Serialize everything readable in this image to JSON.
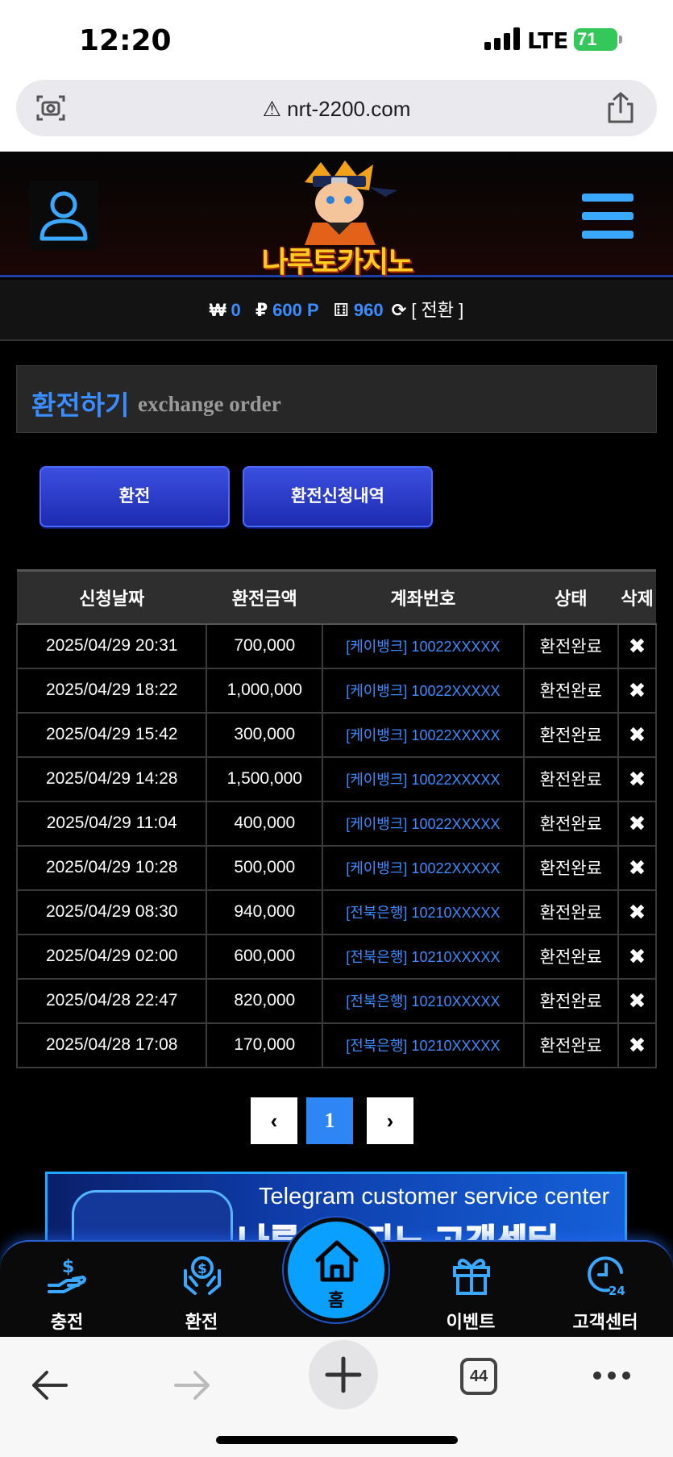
{
  "status_bar": {
    "time": "12:20",
    "network": "LTE",
    "battery": "71"
  },
  "browser": {
    "url": "nrt-2200.com",
    "tab_count": "44"
  },
  "header": {
    "logo_text": "나루토카지노"
  },
  "balance": {
    "won_icon": "₩",
    "won_value": "0",
    "point_icon": "₽",
    "point_value": "600 P",
    "chip_icon": "⚅",
    "chip_value": "960",
    "convert_label": "[ 전환 ]"
  },
  "page": {
    "title_ko": "환전하기",
    "title_en": "exchange order",
    "btn_exchange": "환전",
    "btn_history": "환전신청내역"
  },
  "table": {
    "headers": [
      "신청날짜",
      "환전금액",
      "계좌번호",
      "상태",
      "삭제"
    ],
    "rows": [
      {
        "date": "2025/04/29 20:31",
        "amount": "700,000",
        "account": "[케이뱅크] 10022XXXXX",
        "status": "환전완료",
        "delete": "✖"
      },
      {
        "date": "2025/04/29 18:22",
        "amount": "1,000,000",
        "account": "[케이뱅크] 10022XXXXX",
        "status": "환전완료",
        "delete": "✖"
      },
      {
        "date": "2025/04/29 15:42",
        "amount": "300,000",
        "account": "[케이뱅크] 10022XXXXX",
        "status": "환전완료",
        "delete": "✖"
      },
      {
        "date": "2025/04/29 14:28",
        "amount": "1,500,000",
        "account": "[케이뱅크] 10022XXXXX",
        "status": "환전완료",
        "delete": "✖"
      },
      {
        "date": "2025/04/29 11:04",
        "amount": "400,000",
        "account": "[케이뱅크] 10022XXXXX",
        "status": "환전완료",
        "delete": "✖"
      },
      {
        "date": "2025/04/29 10:28",
        "amount": "500,000",
        "account": "[케이뱅크] 10022XXXXX",
        "status": "환전완료",
        "delete": "✖"
      },
      {
        "date": "2025/04/29 08:30",
        "amount": "940,000",
        "account": "[전북은행] 10210XXXXX",
        "status": "환전완료",
        "delete": "✖"
      },
      {
        "date": "2025/04/29 02:00",
        "amount": "600,000",
        "account": "[전북은행] 10210XXXXX",
        "status": "환전완료",
        "delete": "✖"
      },
      {
        "date": "2025/04/28 22:47",
        "amount": "820,000",
        "account": "[전북은행] 10210XXXXX",
        "status": "환전완료",
        "delete": "✖"
      },
      {
        "date": "2025/04/28 17:08",
        "amount": "170,000",
        "account": "[전북은행] 10210XXXXX",
        "status": "환전완료",
        "delete": "✖"
      }
    ]
  },
  "pagination": {
    "prev": "‹",
    "current": "1",
    "next": "›"
  },
  "banner": {
    "title_en": "Telegram customer service center",
    "title_ko": "나루토카지노 고객센터"
  },
  "bottom_nav": {
    "charge": "충전",
    "exchange": "환전",
    "home": "홈",
    "event": "이벤트",
    "support": "고객센터"
  },
  "colors": {
    "accent": "#3a8cff",
    "button": "#2a3dd0",
    "home": "#0aa0ff"
  }
}
